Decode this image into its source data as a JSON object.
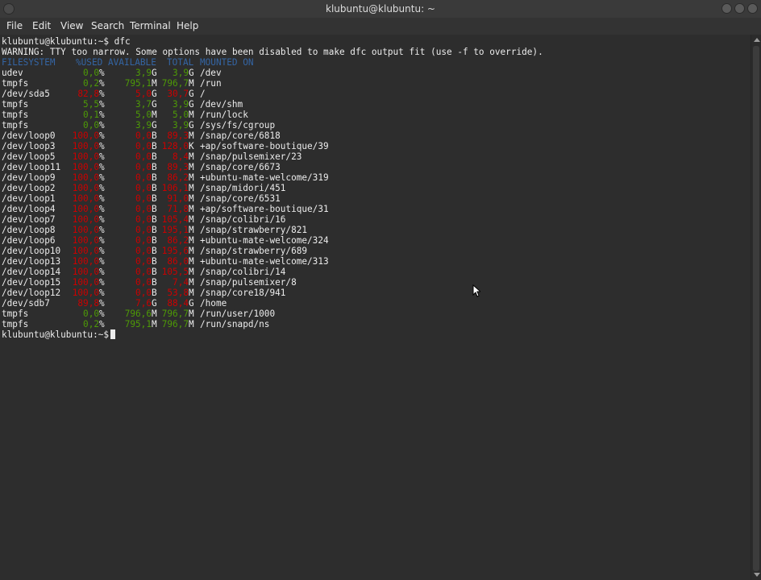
{
  "window": {
    "title": "klubuntu@klubuntu: ~"
  },
  "menu": [
    "File",
    "Edit",
    "View",
    "Search",
    "Terminal",
    "Help"
  ],
  "terminal": {
    "command_line": "klubuntu@klubuntu:~$ dfc",
    "warning": "WARNING: TTY too narrow. Some options have been disabled to make dfc output fit (use -f to override).",
    "headers": [
      "FILESYSTEM",
      "%USED",
      "AVAILABLE",
      "TOTAL",
      "MOUNTED ON"
    ],
    "rows": [
      {
        "fs": "udev",
        "used": "0,0",
        "avail": "3,9",
        "aunit": "G",
        "total": "3,9",
        "tunit": "G",
        "mount": "/dev"
      },
      {
        "fs": "tmpfs",
        "used": "0,2",
        "avail": "795,1",
        "aunit": "M",
        "total": "796,7",
        "tunit": "M",
        "mount": "/run"
      },
      {
        "fs": "/dev/sda5",
        "used": "82,8",
        "avail": "5,0",
        "aunit": "G",
        "total": "30,7",
        "tunit": "G",
        "mount": "/"
      },
      {
        "fs": "tmpfs",
        "used": "5,5",
        "avail": "3,7",
        "aunit": "G",
        "total": "3,9",
        "tunit": "G",
        "mount": "/dev/shm"
      },
      {
        "fs": "tmpfs",
        "used": "0,1",
        "avail": "5,0",
        "aunit": "M",
        "total": "5,0",
        "tunit": "M",
        "mount": "/run/lock"
      },
      {
        "fs": "tmpfs",
        "used": "0,0",
        "avail": "3,9",
        "aunit": "G",
        "total": "3,9",
        "tunit": "G",
        "mount": "/sys/fs/cgroup"
      },
      {
        "fs": "/dev/loop0",
        "used": "100,0",
        "avail": "0,0",
        "aunit": "B",
        "total": "89,3",
        "tunit": "M",
        "mount": "/snap/core/6818"
      },
      {
        "fs": "/dev/loop3",
        "used": "100,0",
        "avail": "0,0",
        "aunit": "B",
        "total": "128,0",
        "tunit": "K",
        "mount": "+ap/software-boutique/39"
      },
      {
        "fs": "/dev/loop5",
        "used": "100,0",
        "avail": "0,0",
        "aunit": "B",
        "total": "8,4",
        "tunit": "M",
        "mount": "/snap/pulsemixer/23"
      },
      {
        "fs": "/dev/loop11",
        "used": "100,0",
        "avail": "0,0",
        "aunit": "B",
        "total": "89,3",
        "tunit": "M",
        "mount": "/snap/core/6673"
      },
      {
        "fs": "/dev/loop9",
        "used": "100,0",
        "avail": "0,0",
        "aunit": "B",
        "total": "86,2",
        "tunit": "M",
        "mount": "+ubuntu-mate-welcome/319"
      },
      {
        "fs": "/dev/loop2",
        "used": "100,0",
        "avail": "0,0",
        "aunit": "B",
        "total": "106,1",
        "tunit": "M",
        "mount": "/snap/midori/451"
      },
      {
        "fs": "/dev/loop1",
        "used": "100,0",
        "avail": "0,0",
        "aunit": "B",
        "total": "91,0",
        "tunit": "M",
        "mount": "/snap/core/6531"
      },
      {
        "fs": "/dev/loop4",
        "used": "100,0",
        "avail": "0,0",
        "aunit": "B",
        "total": "71,8",
        "tunit": "M",
        "mount": "+ap/software-boutique/31"
      },
      {
        "fs": "/dev/loop7",
        "used": "100,0",
        "avail": "0,0",
        "aunit": "B",
        "total": "105,4",
        "tunit": "M",
        "mount": "/snap/colibri/16"
      },
      {
        "fs": "/dev/loop8",
        "used": "100,0",
        "avail": "0,0",
        "aunit": "B",
        "total": "195,1",
        "tunit": "M",
        "mount": "/snap/strawberry/821"
      },
      {
        "fs": "/dev/loop6",
        "used": "100,0",
        "avail": "0,0",
        "aunit": "B",
        "total": "86,2",
        "tunit": "M",
        "mount": "+ubuntu-mate-welcome/324"
      },
      {
        "fs": "/dev/loop10",
        "used": "100,0",
        "avail": "0,0",
        "aunit": "B",
        "total": "195,6",
        "tunit": "M",
        "mount": "/snap/strawberry/689"
      },
      {
        "fs": "/dev/loop13",
        "used": "100,0",
        "avail": "0,0",
        "aunit": "B",
        "total": "86,0",
        "tunit": "M",
        "mount": "+ubuntu-mate-welcome/313"
      },
      {
        "fs": "/dev/loop14",
        "used": "100,0",
        "avail": "0,0",
        "aunit": "B",
        "total": "105,5",
        "tunit": "M",
        "mount": "/snap/colibri/14"
      },
      {
        "fs": "/dev/loop15",
        "used": "100,0",
        "avail": "0,0",
        "aunit": "B",
        "total": "7,4",
        "tunit": "M",
        "mount": "/snap/pulsemixer/8"
      },
      {
        "fs": "/dev/loop12",
        "used": "100,0",
        "avail": "0,0",
        "aunit": "B",
        "total": "53,8",
        "tunit": "M",
        "mount": "/snap/core18/941"
      },
      {
        "fs": "/dev/sdb7",
        "used": "89,8",
        "avail": "7,6",
        "aunit": "G",
        "total": "88,4",
        "tunit": "G",
        "mount": "/home"
      },
      {
        "fs": "tmpfs",
        "used": "0,0",
        "avail": "796,6",
        "aunit": "M",
        "total": "796,7",
        "tunit": "M",
        "mount": "/run/user/1000"
      },
      {
        "fs": "tmpfs",
        "used": "0,2",
        "avail": "795,1",
        "aunit": "M",
        "total": "796,7",
        "tunit": "M",
        "mount": "/run/snapd/ns"
      }
    ],
    "prompt": "klubuntu@klubuntu:~$"
  },
  "colors": {
    "header": "#3465a4",
    "ok": "#4e9a06",
    "full": "#cc0000",
    "text": "#ececec"
  }
}
